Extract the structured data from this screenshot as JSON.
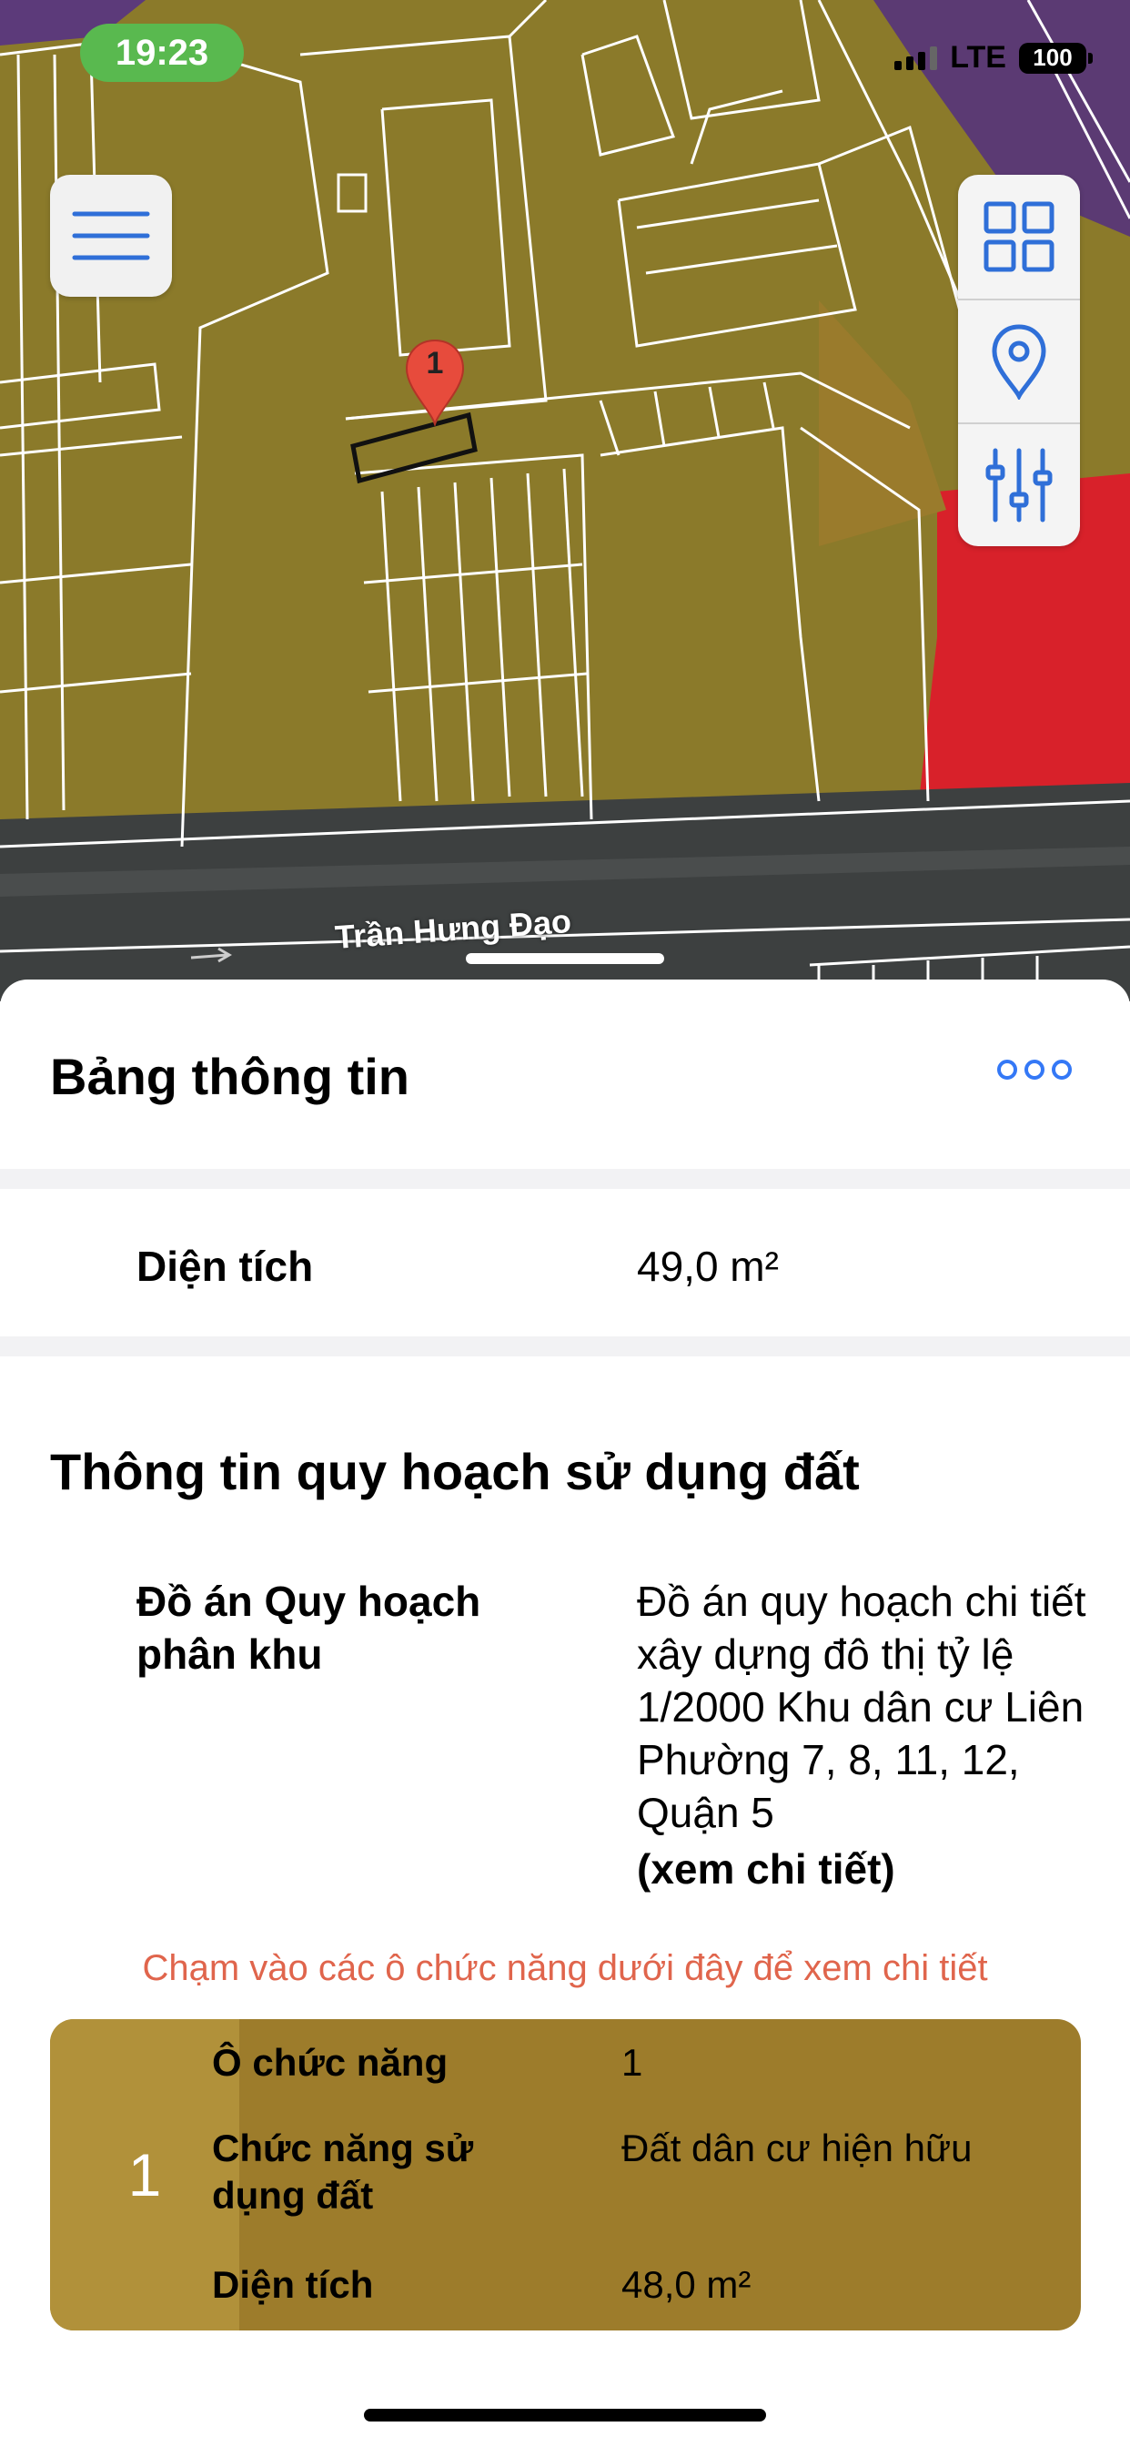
{
  "status_bar": {
    "time": "19:23",
    "network": "LTE",
    "battery": "100"
  },
  "map": {
    "street_name": "Trần Hưng Đạo",
    "marker_label": "1",
    "colors": {
      "residential_zone": "#8b7a2a",
      "commercial_zone": "#d8212a",
      "road": "#3d4040",
      "parcel_lines": "#ffffff"
    },
    "icons": {
      "menu": "hamburger-menu-icon",
      "layers": "grid-layers-icon",
      "location": "location-pin-icon",
      "filter": "sliders-icon"
    }
  },
  "info_panel": {
    "title": "Bảng thông tin",
    "area": {
      "label": "Diện tích",
      "value": "49,0 m²"
    }
  },
  "planning": {
    "section_title": "Thông tin quy hoạch sử dụng đất",
    "plan_label": "Đồ án Quy hoạch phân khu",
    "plan_value": "Đồ án quy hoạch chi tiết xây dựng đô thị tỷ lệ 1/2000 Khu dân cư Liên Phường 7, 8, 11, 12, Quận 5",
    "plan_link": "(xem chi tiết)",
    "hint": "Chạm vào các ô chức năng dưới đây để xem chi tiết"
  },
  "function_cell": {
    "number": "1",
    "rows": [
      {
        "label": "Ô chức năng",
        "value": "1"
      },
      {
        "label": "Chức năng sử dụng đất",
        "value": "Đất dân cư hiện hữu"
      },
      {
        "label": "Diện tích",
        "value": "48,0 m²"
      }
    ],
    "colors": {
      "left": "#b1913a",
      "right": "#9d7c2b"
    }
  }
}
